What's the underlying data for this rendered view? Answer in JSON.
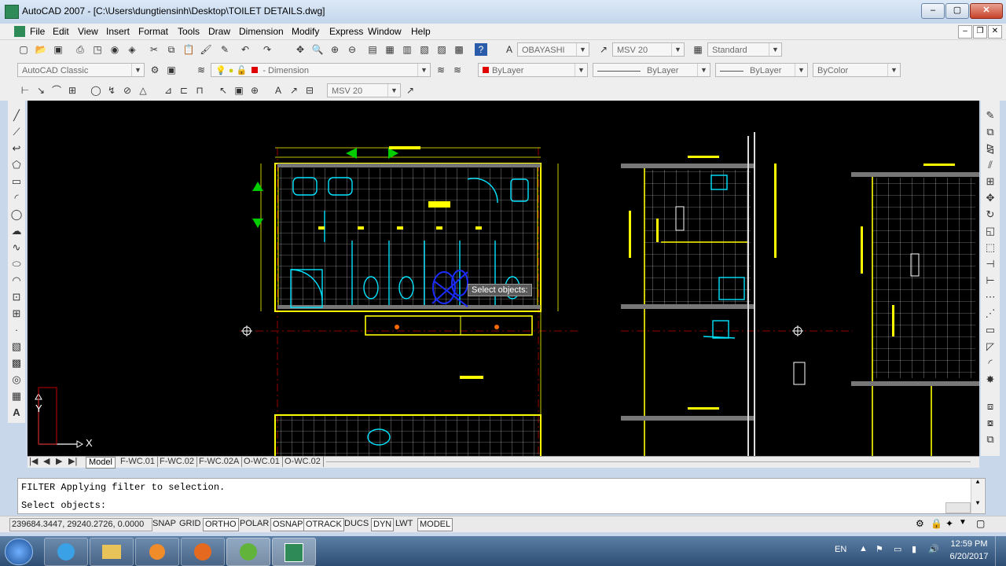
{
  "window": {
    "title": "AutoCAD 2007 - [C:\\Users\\dungtiensinh\\Desktop\\TOILET DETAILS.dwg]",
    "minimize": "–",
    "maximize": "▢",
    "close": "✕"
  },
  "menu": {
    "items": [
      "File",
      "Edit",
      "View",
      "Insert",
      "Format",
      "Tools",
      "Draw",
      "Dimension",
      "Modify",
      "Express",
      "Window",
      "Help"
    ]
  },
  "toolbar": {
    "text_style": "OBAYASHI",
    "dim_style": "MSV 20",
    "table_style": "Standard",
    "workspace": "AutoCAD Classic",
    "layer": "Dimension",
    "color": "ByLayer",
    "linetype": "ByLayer",
    "lineweight": "ByLayer",
    "plotstyle": "ByColor",
    "dim_style_2": "MSV 20"
  },
  "drawing": {
    "tooltip": "Select objects:",
    "ucs_x": "X",
    "ucs_y": "Y"
  },
  "tabs": [
    "Model",
    "F-WC.01",
    "F-WC.02",
    "F-WC.02A",
    "O-WC.01",
    "O-WC.02"
  ],
  "command": {
    "line1": "FILTER Applying filter to selection.",
    "line2": "Select objects:"
  },
  "status": {
    "coords": "239684.3447, 29240.2726, 0.0000",
    "buttons": [
      "SNAP",
      "GRID",
      "ORTHO",
      "POLAR",
      "OSNAP",
      "OTRACK",
      "DUCS",
      "DYN",
      "LWT",
      "MODEL"
    ]
  },
  "taskbar": {
    "language": "EN",
    "time": "12:59 PM",
    "date": "6/20/2017"
  },
  "colors": {
    "cad_background": "#000000",
    "wall_yellow": "#ffff00",
    "fixture_cyan": "#00ffff",
    "selection_blue": "#1a2cff"
  }
}
